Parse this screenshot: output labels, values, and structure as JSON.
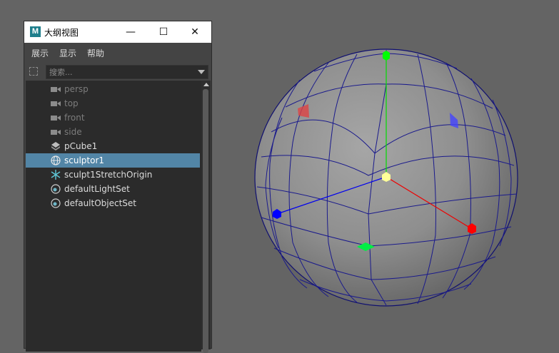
{
  "window": {
    "app_logo": "M",
    "title": "大纲视图",
    "minimize_icon": "—",
    "maximize_icon": "☐",
    "close_icon": "✕"
  },
  "menu": [
    "展示",
    "显示",
    "帮助"
  ],
  "search": {
    "placeholder": "搜索..."
  },
  "outliner_items": [
    {
      "label": "persp",
      "icon": "camera-icon",
      "dimmed": true,
      "selected": false
    },
    {
      "label": "top",
      "icon": "camera-icon",
      "dimmed": true,
      "selected": false
    },
    {
      "label": "front",
      "icon": "camera-icon",
      "dimmed": true,
      "selected": false
    },
    {
      "label": "side",
      "icon": "camera-icon",
      "dimmed": true,
      "selected": false
    },
    {
      "label": "pCube1",
      "icon": "mesh-transform-icon",
      "dimmed": false,
      "selected": false
    },
    {
      "label": "sculptor1",
      "icon": "sculpt-deformer-icon",
      "dimmed": false,
      "selected": true
    },
    {
      "label": "sculpt1StretchOrigin",
      "icon": "locator-icon",
      "dimmed": false,
      "selected": false
    },
    {
      "label": "defaultLightSet",
      "icon": "object-set-icon",
      "dimmed": false,
      "selected": false
    },
    {
      "label": "defaultObjectSet",
      "icon": "object-set-icon",
      "dimmed": false,
      "selected": false
    }
  ],
  "colors": {
    "viewport_bg": "#646464",
    "selection": "#5285a6",
    "wireframe": "#1a1a8c",
    "axis_x": "#ff0000",
    "axis_y": "#00ff00",
    "axis_z": "#0000ff",
    "pivot": "#ffff99"
  }
}
